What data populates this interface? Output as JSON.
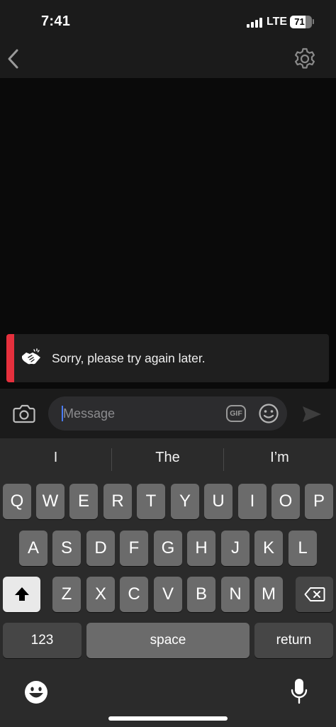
{
  "status_bar": {
    "time": "7:41",
    "network": "LTE",
    "battery": "71",
    "battery_level": 0.71
  },
  "nav": {
    "back_icon": "chevron-left-icon",
    "settings_icon": "gear-icon"
  },
  "error_banner": {
    "text": "Sorry, please try again later.",
    "icon": "handshake-icon",
    "accent_color": "#e5303d"
  },
  "composer": {
    "placeholder": "Message",
    "value": "",
    "gif_label": "GIF",
    "camera_icon": "camera-icon",
    "emoji_icon": "smiley-icon",
    "send_icon": "send-arrow-icon"
  },
  "keyboard": {
    "suggestions": [
      "I",
      "The",
      "I’m"
    ],
    "row1": [
      "Q",
      "W",
      "E",
      "R",
      "T",
      "Y",
      "U",
      "I",
      "O",
      "P"
    ],
    "row2": [
      "A",
      "S",
      "D",
      "F",
      "G",
      "H",
      "J",
      "K",
      "L"
    ],
    "row3": [
      "Z",
      "X",
      "C",
      "V",
      "B",
      "N",
      "M"
    ],
    "numbers_label": "123",
    "space_label": "space",
    "return_label": "return",
    "shift_icon": "shift-icon",
    "delete_icon": "delete-backspace-icon",
    "emoji_icon": "emoji-keyboard-icon",
    "mic_icon": "microphone-icon"
  }
}
